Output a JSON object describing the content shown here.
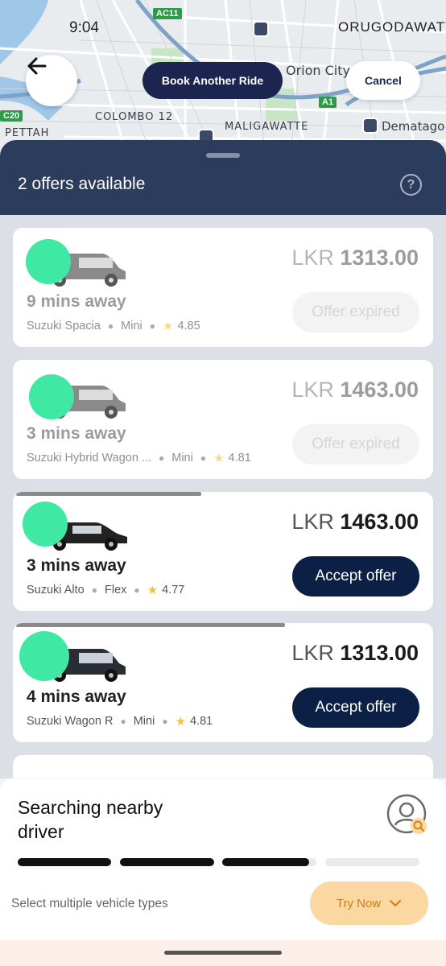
{
  "status_bar": {
    "time": "9:04",
    "right": "ORUGODAWATT"
  },
  "map": {
    "labels": [
      "Orion City",
      "COLOMBO 12",
      "PETTAH",
      "MALIGAWATTE",
      "Dematago"
    ],
    "road_badges": [
      "AC11",
      "A1",
      "C20"
    ]
  },
  "header": {
    "back_icon": "arrow-left-icon",
    "book_label": "Book Another Ride",
    "cancel_label": "Cancel"
  },
  "sheet": {
    "title": "2 offers available",
    "help_icon": "question-circle-icon"
  },
  "offers": [
    {
      "currency": "LKR",
      "amount": "1313.00",
      "eta": "9 mins away",
      "vehicle": "Suzuki Spacia",
      "category": "Mini",
      "rating": "4.85",
      "action": "Offer expired",
      "state": "expired"
    },
    {
      "currency": "LKR",
      "amount": "1463.00",
      "eta": "3 mins away",
      "vehicle": "Suzuki Hybrid Wagon ...",
      "category": "Mini",
      "rating": "4.81",
      "action": "Offer expired",
      "state": "expired"
    },
    {
      "currency": "LKR",
      "amount": "1463.00",
      "eta": "3 mins away",
      "vehicle": "Suzuki Alto",
      "category": "Flex",
      "rating": "4.77",
      "action": "Accept offer",
      "state": "active",
      "time_remaining": 0.44
    },
    {
      "currency": "LKR",
      "amount": "1313.00",
      "eta": "4 mins away",
      "vehicle": "Suzuki Wagon R",
      "category": "Mini",
      "rating": "4.81",
      "action": "Accept offer",
      "state": "active",
      "time_remaining": 0.64
    }
  ],
  "bottom": {
    "title": "Searching nearby driver",
    "progress": [
      1.0,
      1.0,
      0.92,
      0.0
    ],
    "multi_label": "Select multiple vehicle types",
    "try_label": "Try Now",
    "try_icon": "chevron-down-icon"
  },
  "colors": {
    "header_bg": "#2c3c5c",
    "primary": "#0c1f45",
    "accent_soft": "#fbd8a2",
    "accent_text": "#d17b1a"
  }
}
